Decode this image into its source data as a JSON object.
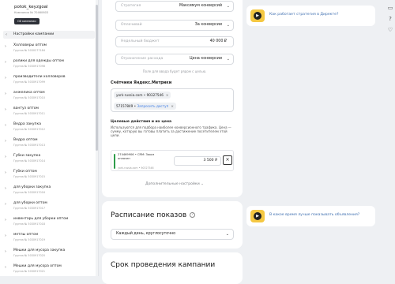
{
  "account": {
    "login": "potok_keyzgoal",
    "client_id": "Кампания № 70460603",
    "badge": "Ой кампании"
  },
  "sidebar": {
    "selected": "Настройки кампании",
    "items": [
      {
        "name": "Холловеры оптом",
        "sub": "Группа № 5030277184"
      },
      {
        "name": "ролики для одежды оптом",
        "sub": "Группа № 5030917098"
      },
      {
        "name": "производители холловеров",
        "sub": "Группа № 5030917099"
      },
      {
        "name": "анжелика оптом",
        "sub": "Группа № 5030917010"
      },
      {
        "name": "вантуз оптом",
        "sub": "Группа № 5030917011"
      },
      {
        "name": "Ведра закупка",
        "sub": "Группа № 5030917012"
      },
      {
        "name": "Ведра оптом",
        "sub": "Группа № 5030917013"
      },
      {
        "name": "Губки закупка",
        "sub": "Группа № 5030917014"
      },
      {
        "name": "Губки оптом",
        "sub": "Группа № 5030917015"
      },
      {
        "name": "для уборки закупка",
        "sub": "Группа № 5030917016"
      },
      {
        "name": "для уборки оптом",
        "sub": "Группа № 5030917017"
      },
      {
        "name": "инвентарь для уборки оптом",
        "sub": "Группа № 5030917018"
      },
      {
        "name": "метлы оптом",
        "sub": "Группа № 5030917019"
      },
      {
        "name": "Мешки для мусора закупка",
        "sub": "Группа № 5030917020"
      },
      {
        "name": "Мешки для мусора оптом",
        "sub": "Группа № 5030917021"
      }
    ]
  },
  "strategy": {
    "strategy_label": "Стратегия",
    "strategy_value": "Максимум конверсий",
    "pay_label": "Оплачивай",
    "pay_value": "За конверсии",
    "budget_label": "Недельный бюджет",
    "budget_value": "40 000 ₽",
    "limit_label": "Ограничение расхода",
    "limit_value": "Цена конверсии",
    "hint": "Поле для ввода будет рядом с целью."
  },
  "metrika": {
    "title": "Счётчики Яндекс.Метрики",
    "counters": [
      "york-russia.com • 90327546",
      "57157849 •"
    ],
    "request_label": "Запросить доступ"
  },
  "goals": {
    "title": "Целевые действия и их цена",
    "desc": "Используются для подбора наиболее конверсионного трафика. Цена — сумму, которую вы готовы платить за достижение посетителем этой цели.",
    "items": [
      {
        "name": "274469906 • CRM: Заказ оплачен",
        "sub": "york-russia.com • 90327546",
        "price": "3 500 ₽"
      }
    ]
  },
  "advanced": {
    "label": "Дополнительные настройки"
  },
  "schedule": {
    "title": "Расписание показов",
    "value": "Каждый день, круглосуточно"
  },
  "period": {
    "title": "Срок проведения кампании"
  },
  "help": {
    "card1": "Как работает стратегия в Директе?",
    "card2": "В какое время лучше показывать объявления?"
  },
  "colors": {
    "accent": "#f5c842",
    "link": "#3f7ee5",
    "goal": "#2e9c4a"
  }
}
